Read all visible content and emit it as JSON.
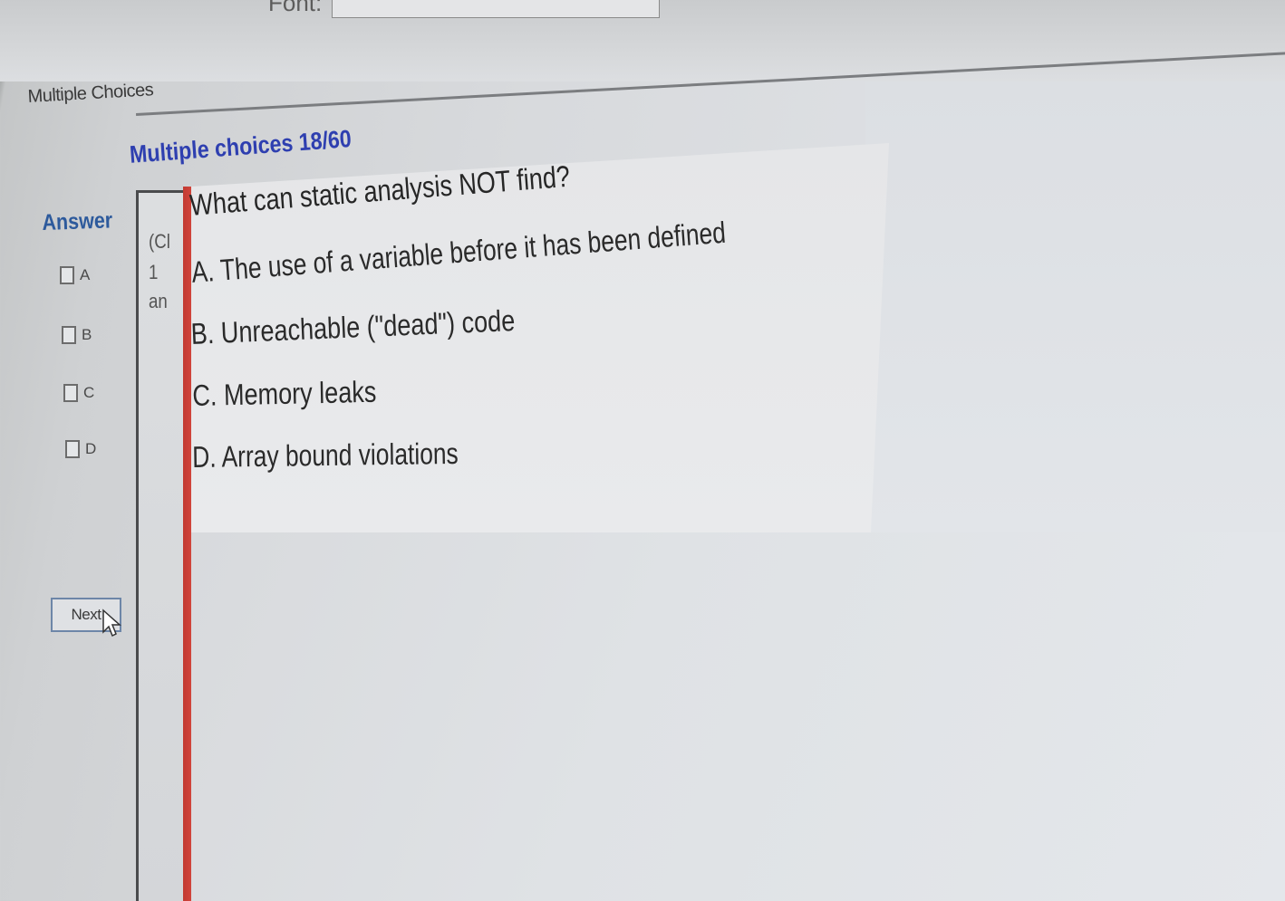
{
  "header": {
    "font_label": "Font:"
  },
  "tab": {
    "label": "Multiple Choices"
  },
  "page_title": "Multiple choices 18/60",
  "answer": {
    "title": "Answer",
    "options": [
      "A",
      "B",
      "C",
      "D"
    ]
  },
  "narrow_column": {
    "lines": [
      "(Cl",
      "1",
      "an"
    ]
  },
  "question": {
    "text": "What can static analysis NOT find?",
    "choices": [
      "A.  The use of a variable before it has been defined",
      "B.  Unreachable (\"dead\") code",
      "C.  Memory leaks",
      "D.  Array bound violations"
    ]
  },
  "buttons": {
    "next_label": "Next"
  },
  "icons": {
    "cursor": "arrow-cursor-icon"
  },
  "colors": {
    "title_blue": "#2e3fb0",
    "answer_blue": "#2d5a9c",
    "accent_red": "#c23a32"
  }
}
